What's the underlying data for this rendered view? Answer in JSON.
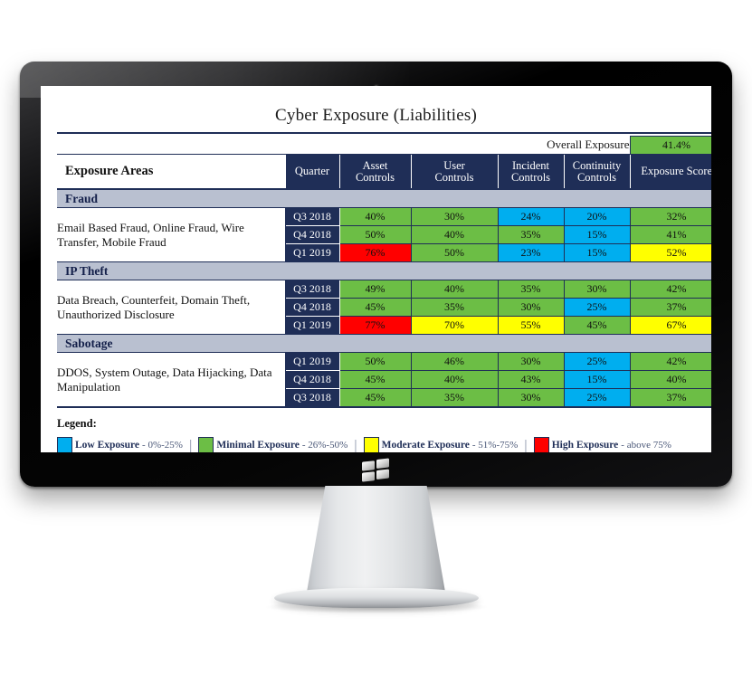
{
  "device": {
    "type": "desktop-monitor",
    "os_logo": "windows-logo"
  },
  "slide": {
    "title": "Cyber Exposure (Liabilities)",
    "overall": {
      "label": "Overall Exposure",
      "value": "41.4%",
      "color": "#6CBE45"
    },
    "columns": {
      "areas": "Exposure Areas",
      "quarter": "Quarter",
      "asset": "Asset\nControls",
      "asset_l1": "Asset",
      "asset_l2": "Controls",
      "user_l1": "User",
      "user_l2": "Controls",
      "incident_l1": "Incident",
      "incident_l2": "Controls",
      "continuity_l1": "Continuity",
      "continuity_l2": "Controls",
      "score": "Exposure Score"
    },
    "sections": [
      {
        "name": "Fraud",
        "area": "Email Based Fraud, Online Fraud, Wire Transfer, Mobile Fraud",
        "rows": [
          {
            "quarter": "Q3 2018",
            "cells": [
              {
                "v": "40%",
                "c": "#6CBE45"
              },
              {
                "v": "30%",
                "c": "#6CBE45"
              },
              {
                "v": "24%",
                "c": "#00AEEF"
              },
              {
                "v": "20%",
                "c": "#00AEEF"
              },
              {
                "v": "32%",
                "c": "#6CBE45"
              }
            ]
          },
          {
            "quarter": "Q4 2018",
            "cells": [
              {
                "v": "50%",
                "c": "#6CBE45"
              },
              {
                "v": "40%",
                "c": "#6CBE45"
              },
              {
                "v": "35%",
                "c": "#6CBE45"
              },
              {
                "v": "15%",
                "c": "#00AEEF"
              },
              {
                "v": "41%",
                "c": "#6CBE45"
              }
            ]
          },
          {
            "quarter": "Q1 2019",
            "cells": [
              {
                "v": "76%",
                "c": "#FF0000"
              },
              {
                "v": "50%",
                "c": "#6CBE45"
              },
              {
                "v": "23%",
                "c": "#00AEEF"
              },
              {
                "v": "15%",
                "c": "#00AEEF"
              },
              {
                "v": "52%",
                "c": "#FFFF00"
              }
            ]
          }
        ]
      },
      {
        "name": "IP Theft",
        "area": "Data Breach, Counterfeit, Domain Theft, Unauthorized Disclosure",
        "rows": [
          {
            "quarter": "Q3 2018",
            "cells": [
              {
                "v": "49%",
                "c": "#6CBE45"
              },
              {
                "v": "40%",
                "c": "#6CBE45"
              },
              {
                "v": "35%",
                "c": "#6CBE45"
              },
              {
                "v": "30%",
                "c": "#6CBE45"
              },
              {
                "v": "42%",
                "c": "#6CBE45"
              }
            ]
          },
          {
            "quarter": "Q4 2018",
            "cells": [
              {
                "v": "45%",
                "c": "#6CBE45"
              },
              {
                "v": "35%",
                "c": "#6CBE45"
              },
              {
                "v": "30%",
                "c": "#6CBE45"
              },
              {
                "v": "25%",
                "c": "#00AEEF"
              },
              {
                "v": "37%",
                "c": "#6CBE45"
              }
            ]
          },
          {
            "quarter": "Q1 2019",
            "cells": [
              {
                "v": "77%",
                "c": "#FF0000"
              },
              {
                "v": "70%",
                "c": "#FFFF00"
              },
              {
                "v": "55%",
                "c": "#FFFF00"
              },
              {
                "v": "45%",
                "c": "#6CBE45"
              },
              {
                "v": "67%",
                "c": "#FFFF00"
              }
            ]
          }
        ]
      },
      {
        "name": "Sabotage",
        "area": "DDOS, System Outage, Data Hijacking, Data Manipulation",
        "rows": [
          {
            "quarter": "Q1 2019",
            "cells": [
              {
                "v": "50%",
                "c": "#6CBE45"
              },
              {
                "v": "46%",
                "c": "#6CBE45"
              },
              {
                "v": "30%",
                "c": "#6CBE45"
              },
              {
                "v": "25%",
                "c": "#00AEEF"
              },
              {
                "v": "42%",
                "c": "#6CBE45"
              }
            ]
          },
          {
            "quarter": "Q4 2018",
            "cells": [
              {
                "v": "45%",
                "c": "#6CBE45"
              },
              {
                "v": "40%",
                "c": "#6CBE45"
              },
              {
                "v": "43%",
                "c": "#6CBE45"
              },
              {
                "v": "15%",
                "c": "#00AEEF"
              },
              {
                "v": "40%",
                "c": "#6CBE45"
              }
            ]
          },
          {
            "quarter": "Q3 2018",
            "cells": [
              {
                "v": "45%",
                "c": "#6CBE45"
              },
              {
                "v": "35%",
                "c": "#6CBE45"
              },
              {
                "v": "30%",
                "c": "#6CBE45"
              },
              {
                "v": "25%",
                "c": "#00AEEF"
              },
              {
                "v": "37%",
                "c": "#6CBE45"
              }
            ]
          }
        ]
      }
    ],
    "legend": {
      "title": "Legend:",
      "separator": "|",
      "items": [
        {
          "name": "Low Exposure",
          "range": "- 0%-25%",
          "color": "#00AEEF"
        },
        {
          "name": "Minimal Exposure",
          "range": "- 26%-50%",
          "color": "#6CBE45"
        },
        {
          "name": "Moderate Exposure",
          "range": "- 51%-75%",
          "color": "#FFFF00"
        },
        {
          "name": "High Exposure",
          "range": "- above 75%",
          "color": "#FF0000"
        }
      ]
    }
  },
  "chart_data": {
    "type": "heatmap",
    "title": "Cyber Exposure (Liabilities)",
    "row_label": "Exposure Areas",
    "columns": [
      "Quarter",
      "Asset Controls",
      "User Controls",
      "Incident Controls",
      "Continuity Controls",
      "Exposure Score"
    ],
    "overall_exposure": 41.4,
    "color_scale": [
      {
        "label": "Low Exposure",
        "min": 0,
        "max": 25,
        "color": "#00AEEF"
      },
      {
        "label": "Minimal Exposure",
        "min": 26,
        "max": 50,
        "color": "#6CBE45"
      },
      {
        "label": "Moderate Exposure",
        "min": 51,
        "max": 75,
        "color": "#FFFF00"
      },
      {
        "label": "High Exposure",
        "min": 76,
        "max": 100,
        "color": "#FF0000"
      }
    ],
    "groups": [
      {
        "name": "Fraud",
        "detail": "Email Based Fraud, Online Fraud, Wire Transfer, Mobile Fraud",
        "rows": [
          {
            "quarter": "Q3 2018",
            "asset_controls": 40,
            "user_controls": 30,
            "incident_controls": 24,
            "continuity_controls": 20,
            "exposure_score": 32
          },
          {
            "quarter": "Q4 2018",
            "asset_controls": 50,
            "user_controls": 40,
            "incident_controls": 35,
            "continuity_controls": 15,
            "exposure_score": 41
          },
          {
            "quarter": "Q1 2019",
            "asset_controls": 76,
            "user_controls": 50,
            "incident_controls": 23,
            "continuity_controls": 15,
            "exposure_score": 52
          }
        ]
      },
      {
        "name": "IP Theft",
        "detail": "Data Breach, Counterfeit, Domain Theft, Unauthorized Disclosure",
        "rows": [
          {
            "quarter": "Q3 2018",
            "asset_controls": 49,
            "user_controls": 40,
            "incident_controls": 35,
            "continuity_controls": 30,
            "exposure_score": 42
          },
          {
            "quarter": "Q4 2018",
            "asset_controls": 45,
            "user_controls": 35,
            "incident_controls": 30,
            "continuity_controls": 25,
            "exposure_score": 37
          },
          {
            "quarter": "Q1 2019",
            "asset_controls": 77,
            "user_controls": 70,
            "incident_controls": 55,
            "continuity_controls": 45,
            "exposure_score": 67
          }
        ]
      },
      {
        "name": "Sabotage",
        "detail": "DDOS, System Outage, Data Hijacking, Data Manipulation",
        "rows": [
          {
            "quarter": "Q1 2019",
            "asset_controls": 50,
            "user_controls": 46,
            "incident_controls": 30,
            "continuity_controls": 25,
            "exposure_score": 42
          },
          {
            "quarter": "Q4 2018",
            "asset_controls": 45,
            "user_controls": 40,
            "incident_controls": 43,
            "continuity_controls": 15,
            "exposure_score": 40
          },
          {
            "quarter": "Q3 2018",
            "asset_controls": 45,
            "user_controls": 35,
            "incident_controls": 30,
            "continuity_controls": 25,
            "exposure_score": 37
          }
        ]
      }
    ]
  }
}
